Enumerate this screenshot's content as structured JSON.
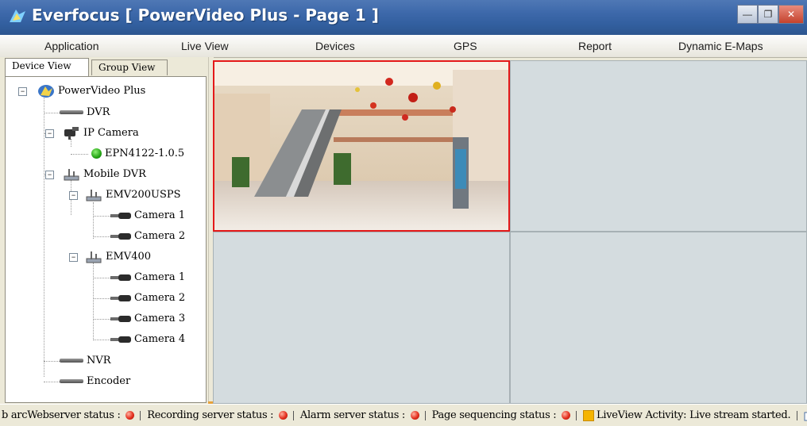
{
  "window": {
    "title": "Everfocus  [ PowerVideo Plus - Page 1 ]",
    "minimize_glyph": "—",
    "restore_glyph": "❐",
    "close_glyph": "✕"
  },
  "menu": {
    "items": [
      "Application",
      "Live View",
      "Devices",
      "GPS",
      "Report",
      "Dynamic E-Maps"
    ]
  },
  "left_panel": {
    "tabs": [
      "Device View",
      "Group View"
    ],
    "tree": {
      "root": "PowerVideo Plus",
      "dvr": "DVR",
      "ip_camera": "IP Camera",
      "ip_camera_child": "EPN4122-1.0.5",
      "mobile_dvr": "Mobile DVR",
      "emv200": "EMV200USPS",
      "emv200_cams": [
        "Camera 1",
        "Camera 2"
      ],
      "emv400": "EMV400",
      "emv400_cams": [
        "Camera 1",
        "Camera 2",
        "Camera 3",
        "Camera 4"
      ],
      "nvr": "NVR",
      "encoder": "Encoder",
      "expander_glyph": "−"
    }
  },
  "status_bar": {
    "overlap_prefix": "b arcWebserver status",
    "recording": "Recording server status :",
    "alarm": "Alarm server status :",
    "page_seq": "Page sequencing status :",
    "liveview": "LiveView Activity: Live stream started.",
    "first_colon": ":"
  },
  "colors": {
    "title_bar": "#3e69ab",
    "selected_cell_border": "#e4191a",
    "status_red": "#e4301f",
    "online_green": "#23a313"
  },
  "icons": {
    "app_logo": "everfocus-logo-icon",
    "device_dvr": "dvr-icon",
    "device_camera": "camera-icon",
    "status_dot": "red-status-icon"
  }
}
